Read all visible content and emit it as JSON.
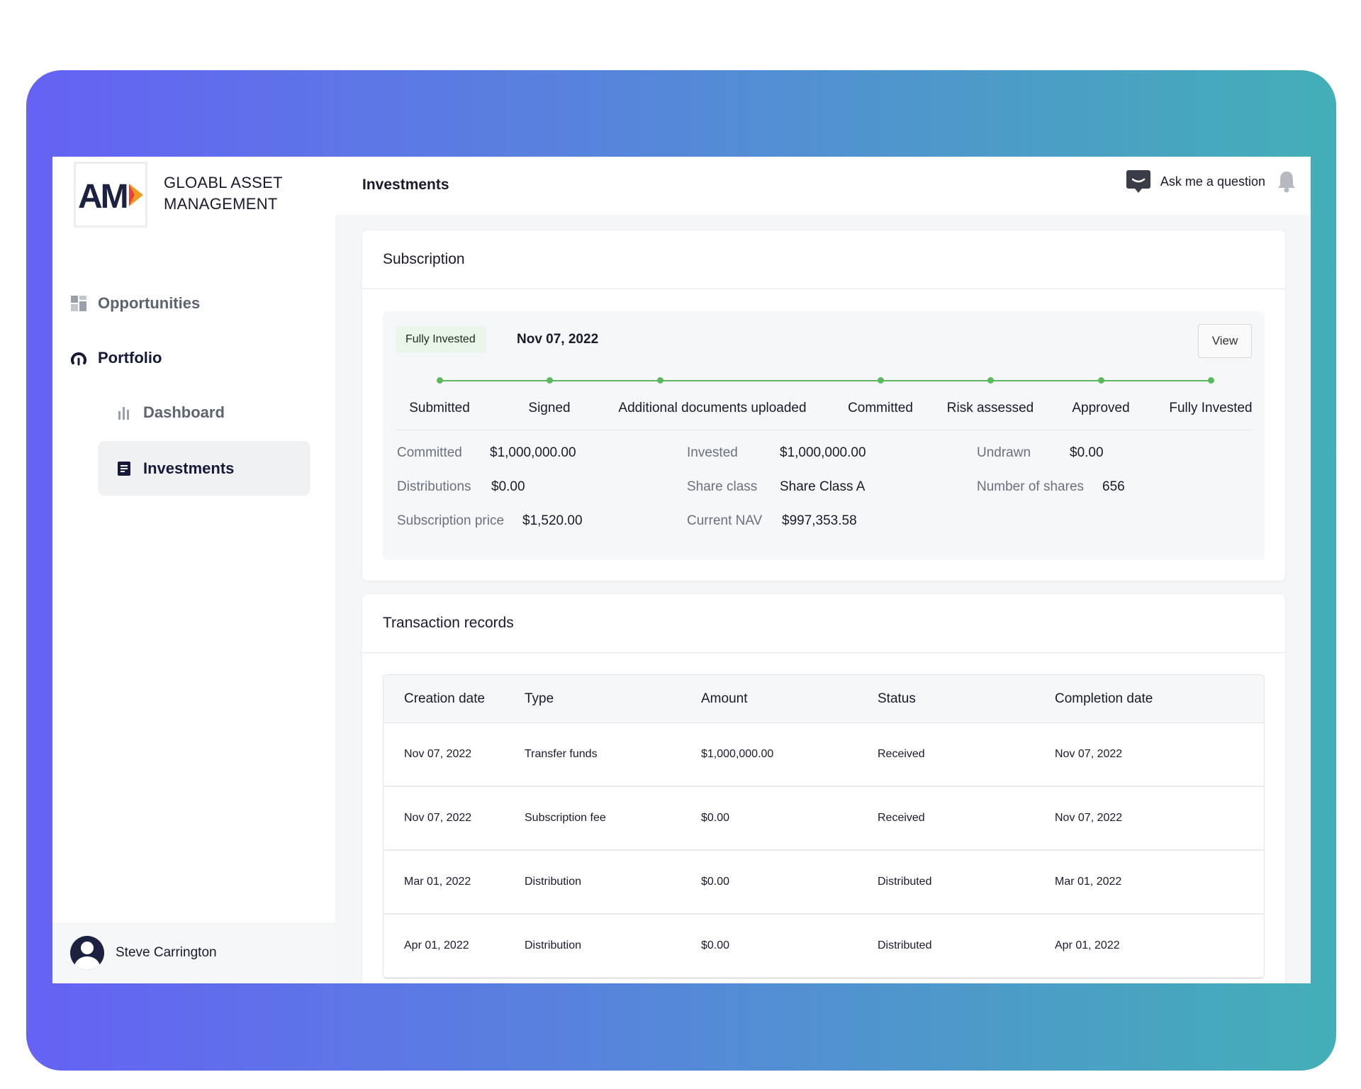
{
  "brand": {
    "logo_text": "AM",
    "name_line1": "GLOABL ASSET",
    "name_line2": "MANAGEMENT"
  },
  "nav": {
    "opportunities": "Opportunities",
    "portfolio": "Portfolio",
    "dashboard": "Dashboard",
    "investments": "Investments"
  },
  "user": {
    "name": "Steve Carrington"
  },
  "header": {
    "title": "Investments",
    "ask_label": "Ask me a question"
  },
  "subscription": {
    "title": "Subscription",
    "badge": "Fully Invested",
    "date": "Nov 07, 2022",
    "view_label": "View",
    "steps": [
      "Submitted",
      "Signed",
      "Additional documents uploaded",
      "Committed",
      "Risk assessed",
      "Approved",
      "Fully Invested"
    ],
    "fields": {
      "committed": {
        "label": "Committed",
        "value": "$1,000,000.00"
      },
      "invested": {
        "label": "Invested",
        "value": "$1,000,000.00"
      },
      "undrawn": {
        "label": "Undrawn",
        "value": "$0.00"
      },
      "distributions": {
        "label": "Distributions",
        "value": "$0.00"
      },
      "share_class": {
        "label": "Share class",
        "value": "Share Class A"
      },
      "number_of_shares": {
        "label": "Number of shares",
        "value": "656"
      },
      "subscription_price": {
        "label": "Subscription price",
        "value": "$1,520.00"
      },
      "current_nav": {
        "label": "Current NAV",
        "value": "$997,353.58"
      }
    }
  },
  "transactions": {
    "title": "Transaction records",
    "columns": [
      "Creation date",
      "Type",
      "Amount",
      "Status",
      "Completion date"
    ],
    "rows": [
      [
        "Nov 07, 2022",
        "Transfer funds",
        "$1,000,000.00",
        "Received",
        "Nov 07, 2022"
      ],
      [
        "Nov 07, 2022",
        "Subscription fee",
        "$0.00",
        "Received",
        "Nov 07, 2022"
      ],
      [
        "Mar 01, 2022",
        "Distribution",
        "$0.00",
        "Distributed",
        "Mar 01, 2022"
      ],
      [
        "Apr 01, 2022",
        "Distribution",
        "$0.00",
        "Distributed",
        "Apr 01, 2022"
      ]
    ]
  },
  "colors": {
    "accent_green": "#5cb85c",
    "frame_start": "#6562f4",
    "frame_end": "#43afb7",
    "nav_dark": "#151a3a"
  }
}
